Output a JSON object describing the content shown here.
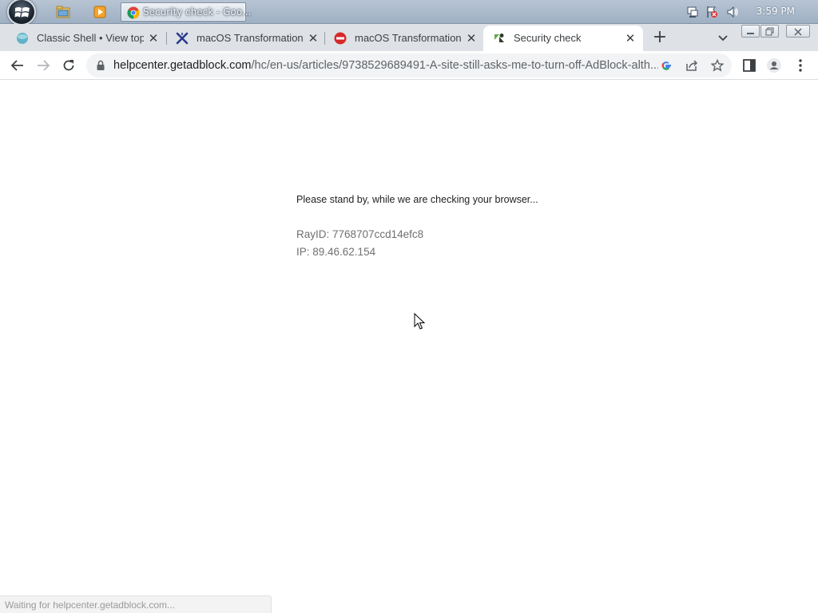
{
  "taskbar": {
    "start_icon": "windows-start-orb",
    "pinned": [
      {
        "name": "file-explorer",
        "icon": "folder-icon"
      },
      {
        "name": "media-player",
        "icon": "media-player-icon"
      }
    ],
    "active_window_label": "Security check - Goo...",
    "tray": {
      "icons": [
        "network-icon",
        "action-center-flag-icon",
        "volume-icon"
      ],
      "clock": "3:59 PM"
    }
  },
  "browser": {
    "tabs": [
      {
        "title": "Classic Shell • View topic",
        "icon": "classic-shell-icon",
        "active": false
      },
      {
        "title": "macOS Transformation Pa",
        "icon": "cross-logo-icon",
        "active": false
      },
      {
        "title": "macOS Transformation Pa",
        "icon": "red-badge-icon",
        "active": false
      },
      {
        "title": "Security check",
        "icon": "zendesk-icon",
        "active": true
      }
    ],
    "new_tab_label": "+",
    "address": {
      "host": "helpcenter.getadblock.com",
      "path": "/hc/en-us/articles/9738529689491-A-site-still-asks-me-to-turn-off-AdBlock-alth..."
    }
  },
  "page": {
    "standby_text": "Please stand by, while we are checking your browser...",
    "ray_id": "RayID: 7768707ccd14efc8",
    "ip": "IP: 89.46.62.154"
  },
  "status_bar": {
    "text": "Waiting for helpcenter.getadblock.com..."
  },
  "colors": {
    "taskbar": "#a9b8c9",
    "tabstrip": "#dee1e6",
    "omnibox": "#f1f3f4",
    "page_text": "#222222",
    "meta_text": "#707070"
  }
}
